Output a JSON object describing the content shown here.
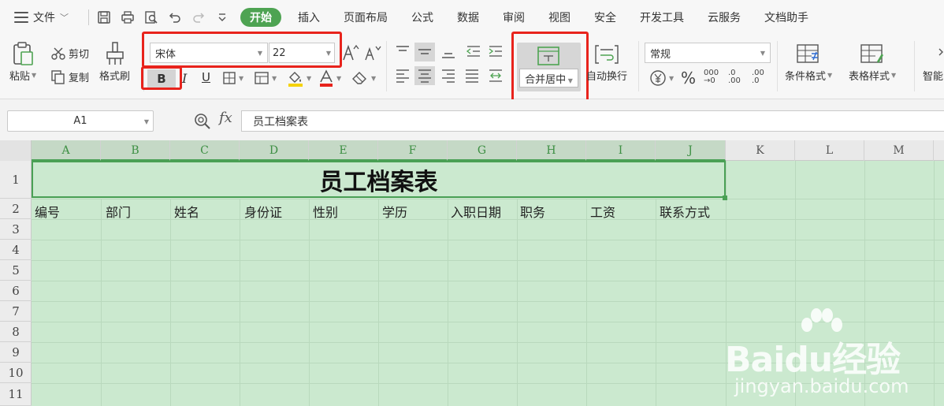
{
  "menubar": {
    "file_label": "文件",
    "tabs": [
      {
        "label": "开始",
        "active": true
      },
      {
        "label": "插入"
      },
      {
        "label": "页面布局"
      },
      {
        "label": "公式"
      },
      {
        "label": "数据"
      },
      {
        "label": "审阅"
      },
      {
        "label": "视图"
      },
      {
        "label": "安全"
      },
      {
        "label": "开发工具"
      },
      {
        "label": "云服务"
      },
      {
        "label": "文档助手"
      }
    ]
  },
  "ribbon": {
    "paste_label": "粘贴",
    "cut_label": "剪切",
    "copy_label": "复制",
    "format_painter_label": "格式刷",
    "font_name": "宋体",
    "font_size": "22",
    "bold_label": "B",
    "italic_label": "I",
    "underline_label": "U",
    "merge_center_label": "合并居中",
    "wrap_label": "自动换行",
    "number_format": "常规",
    "cond_format_label": "条件格式",
    "table_style_label": "表格样式",
    "smart_label": "智能"
  },
  "formula_bar": {
    "name_box": "A1",
    "fx_label": "fx",
    "content": "员工档案表"
  },
  "sheet": {
    "columns": [
      "A",
      "B",
      "C",
      "D",
      "E",
      "F",
      "G",
      "H",
      "I",
      "J",
      "K",
      "L",
      "M"
    ],
    "rows": [
      "1",
      "2",
      "3",
      "4",
      "5",
      "6",
      "7",
      "8",
      "9",
      "10",
      "11"
    ],
    "title": "员工档案表",
    "headers": [
      "编号",
      "部门",
      "姓名",
      "身份证",
      "性别",
      "学历",
      "入职日期",
      "职务",
      "工资",
      "联系方式"
    ]
  },
  "watermark": {
    "brand": "Bai",
    "brand2": "du",
    "brand3": "经验",
    "url": "jingyan.baidu.com"
  },
  "colors": {
    "accent": "#4ea352",
    "highlight_box": "#e8231c",
    "sheet_bg": "#cbe9cf"
  }
}
